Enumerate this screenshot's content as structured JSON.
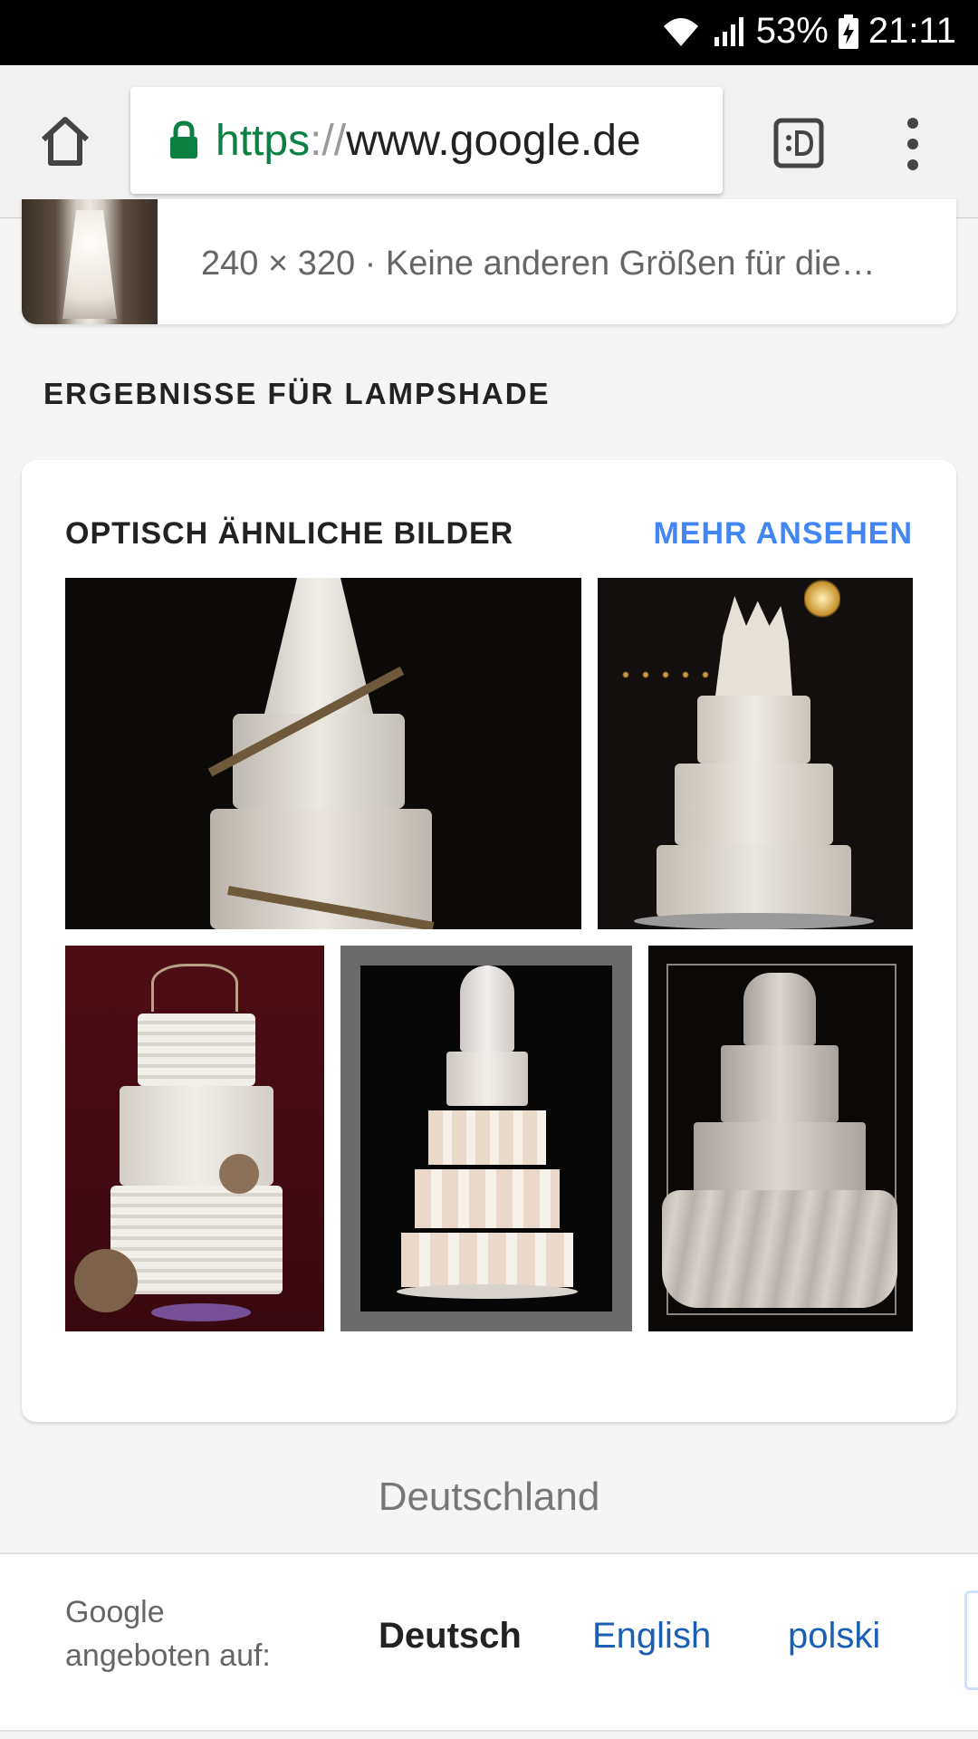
{
  "status_bar": {
    "battery": "53%",
    "time": "21:11"
  },
  "browser": {
    "url_scheme": "https",
    "url_separator": "://",
    "url_host": "www.google.de",
    "icons": [
      "home-icon",
      "lock-icon",
      "desktop-site-icon",
      "overflow-menu-icon"
    ],
    "accent_colors": {
      "lock": "#0b8043",
      "link": "#4285f4"
    }
  },
  "top_result": {
    "meta": "240 × 320 · Keine anderen Größen für die…"
  },
  "results_heading": "ERGEBNISSE FÜR LAMPSHADE",
  "similar": {
    "title": "OPTISCH ÄHNLICHE BILDER",
    "more_label": "MEHR ANSEHEN",
    "images": [
      "cake-image-1",
      "cake-image-2",
      "cake-image-3",
      "cake-image-4",
      "cake-image-5"
    ]
  },
  "footer": {
    "country": "Deutschland",
    "offered_in": "Google angeboten auf:",
    "languages": {
      "current": "Deutsch",
      "other1": "English",
      "other2": "polski"
    }
  }
}
